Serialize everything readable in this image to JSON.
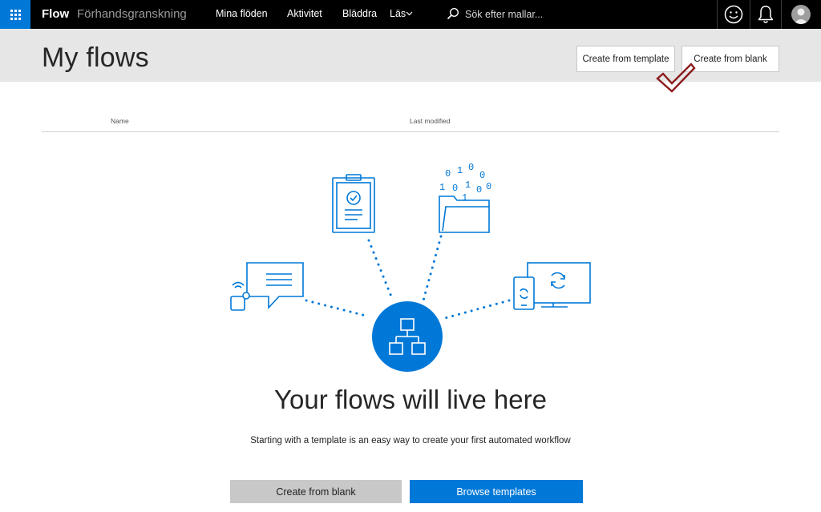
{
  "topbar": {
    "brand": "Flow",
    "subtitle": "Förhandsgranskning",
    "nav": [
      "Mina flöden",
      "Aktivitet",
      "Bläddra",
      "Läs"
    ],
    "search_placeholder": "Sök efter mallar...",
    "icons": [
      "waffle-icon",
      "search-icon",
      "smiley-icon",
      "bell-icon",
      "avatar-icon"
    ]
  },
  "header": {
    "title": "My flows",
    "create_from_template": "Create from template",
    "create_from_blank": "Create from blank"
  },
  "table": {
    "columns": [
      "Name",
      "Last modified"
    ]
  },
  "empty_state": {
    "binary_digits": [
      "0",
      "1",
      "0",
      "0",
      "1",
      "0",
      "1",
      "0",
      "0",
      "1"
    ],
    "title": "Your flows will live here",
    "subtitle": "Starting with a template is an easy way to create your first automated workflow",
    "primary_button": "Create from blank",
    "secondary_button": "Browse templates"
  },
  "colors": {
    "accent": "#0078d7",
    "topbar": "#000000",
    "header_band": "#e6e6e6",
    "annotation_check": "#8b1a1a"
  }
}
